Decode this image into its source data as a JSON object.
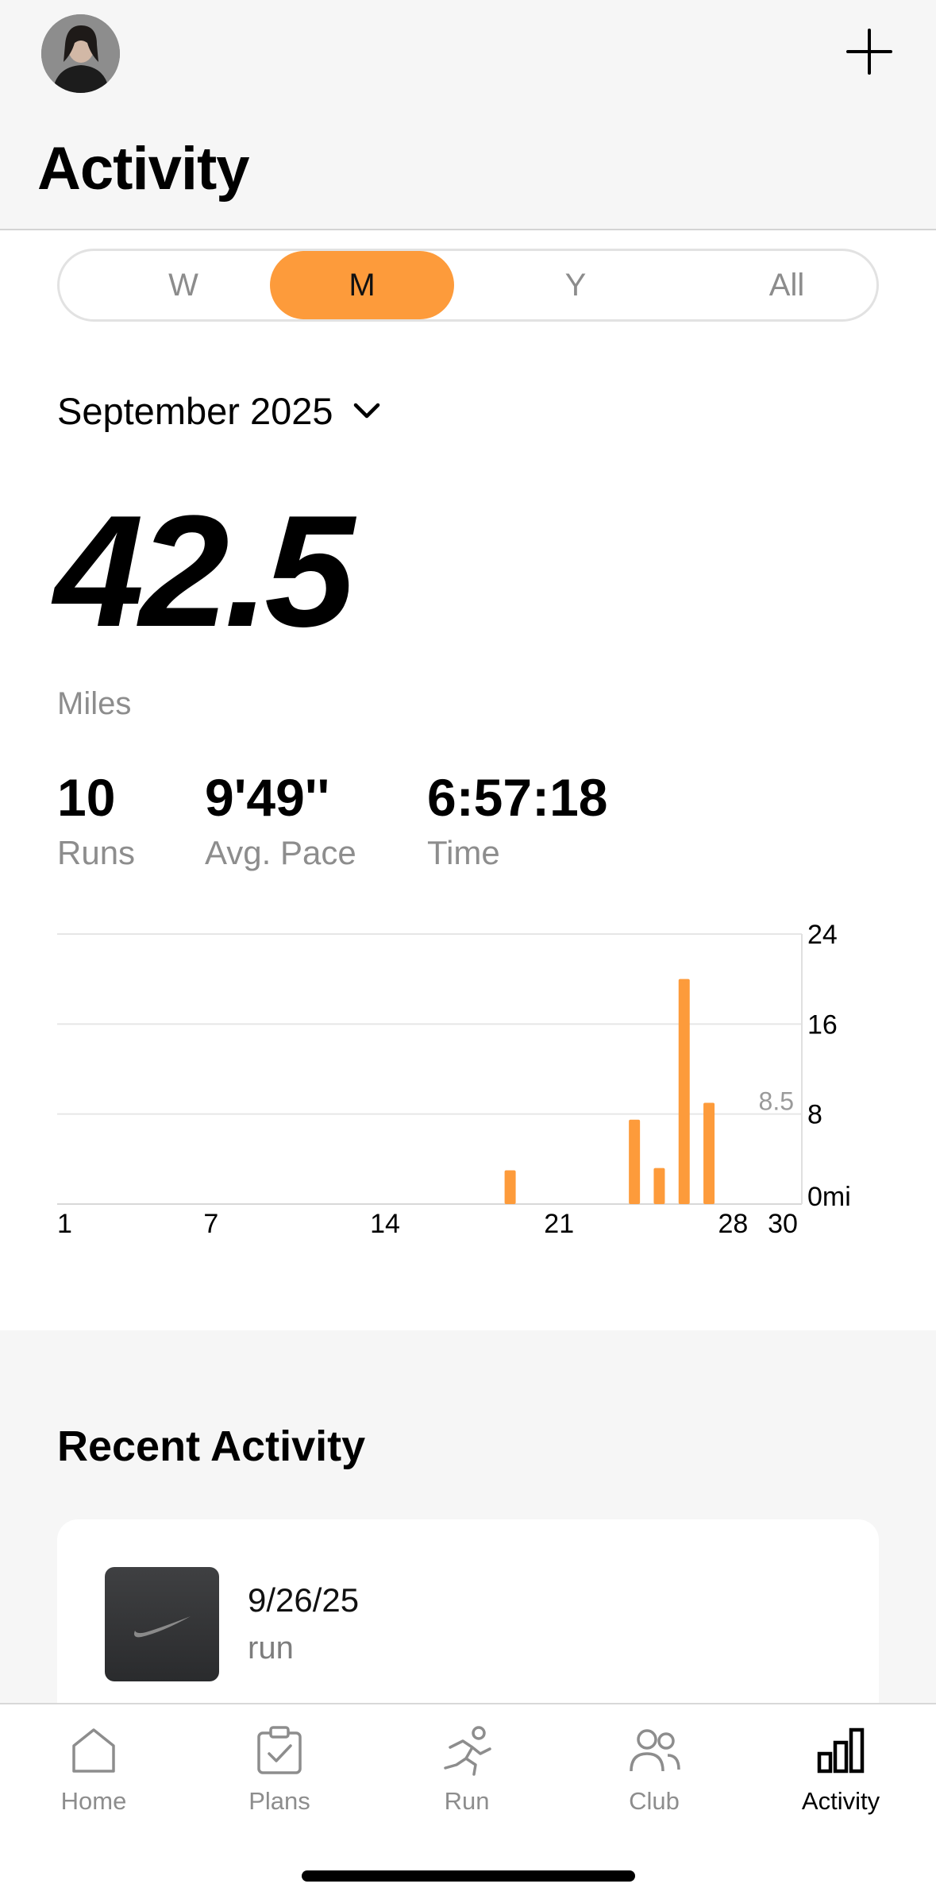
{
  "header": {
    "title": "Activity"
  },
  "segments": [
    "W",
    "M",
    "Y",
    "All"
  ],
  "segments_active": "M",
  "period": {
    "label": "September 2025"
  },
  "summary": {
    "distance": "42.5",
    "distance_unit": "Miles",
    "runs_value": "10",
    "runs_label": "Runs",
    "pace_value": "9'49''",
    "pace_label": "Avg. Pace",
    "time_value": "6:57:18",
    "time_label": "Time"
  },
  "chart_data": {
    "type": "bar",
    "x_ticks": [
      "1",
      "7",
      "14",
      "21",
      "28",
      "30"
    ],
    "y_ticks": [
      "24",
      "16",
      "8",
      "0mi"
    ],
    "ylim": [
      0,
      24
    ],
    "xlim": [
      1,
      30
    ],
    "average_label": "8.5",
    "days": [
      19,
      24,
      25,
      26,
      27
    ],
    "values": [
      3,
      7.5,
      3.2,
      20,
      9
    ]
  },
  "colors": {
    "accent": "#fd9b3b"
  },
  "recent": {
    "title": "Recent Activity",
    "items": [
      {
        "date": "9/26/25",
        "type": "run"
      }
    ]
  },
  "tabs": [
    {
      "label": "Home",
      "icon": "home-icon"
    },
    {
      "label": "Plans",
      "icon": "clipboard-check-icon"
    },
    {
      "label": "Run",
      "icon": "runner-icon"
    },
    {
      "label": "Club",
      "icon": "people-icon"
    },
    {
      "label": "Activity",
      "icon": "bar-chart-icon"
    }
  ]
}
